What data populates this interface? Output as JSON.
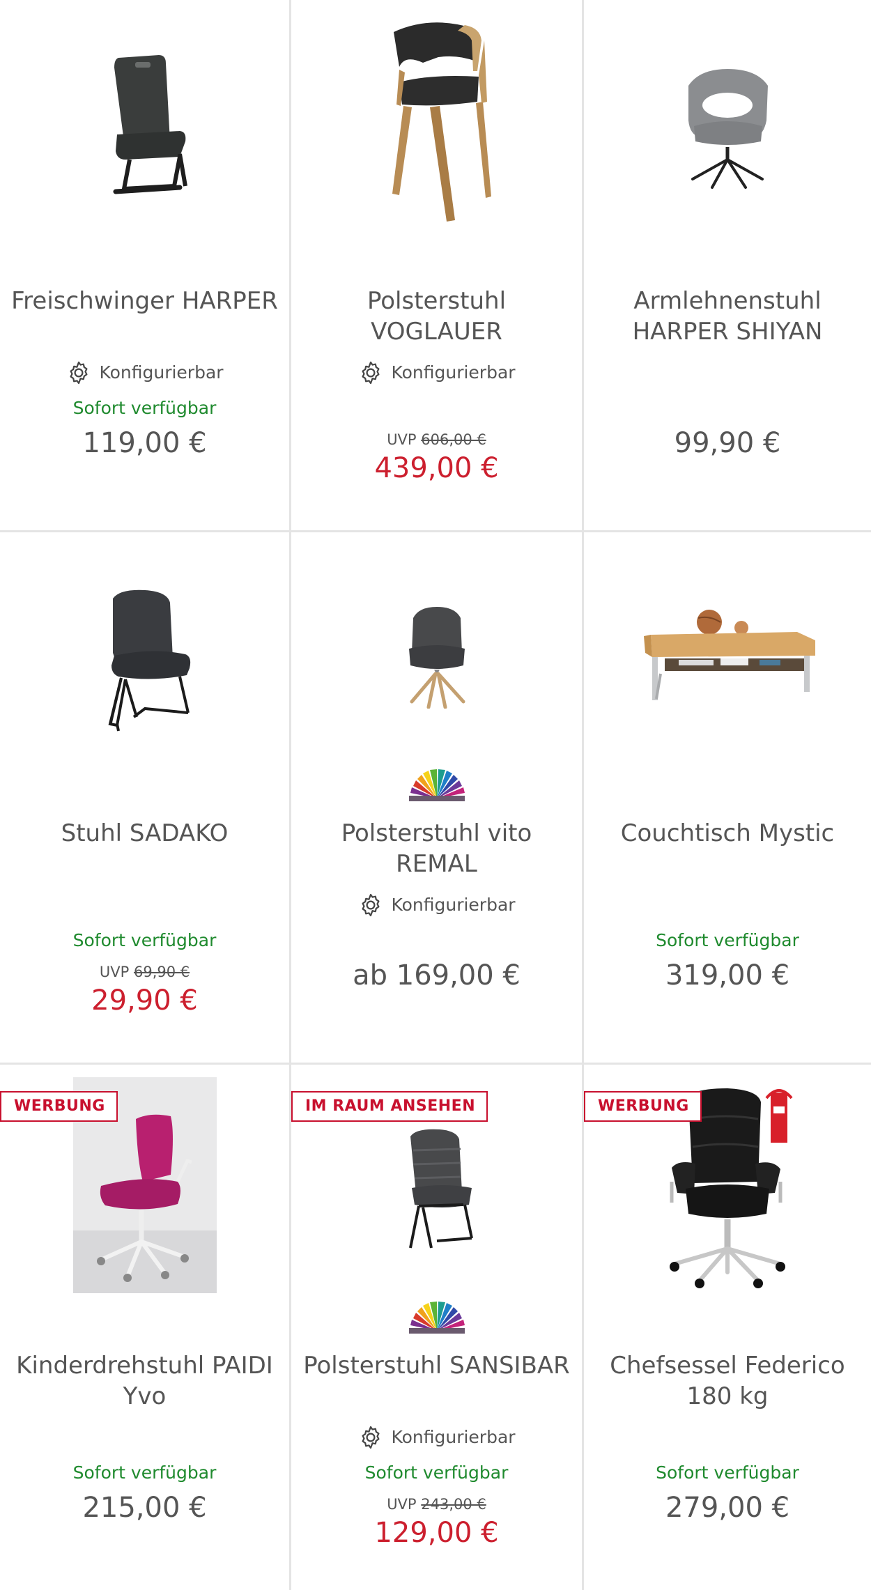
{
  "products": [
    {
      "title": "Freischwinger HARPER",
      "configurable": "Konfigurierbar",
      "availability": "Sofort verfügbar",
      "price": "119,00 €"
    },
    {
      "title": "Polsterstuhl VOGLAUER",
      "configurable": "Konfigurierbar",
      "uvp_label": "UVP",
      "uvp_price": "606,00 €",
      "price": "439,00 €"
    },
    {
      "title": "Armlehnenstuhl HARPER SHIYAN",
      "price": "99,90 €"
    },
    {
      "title": "Stuhl SADAKO",
      "availability": "Sofort verfügbar",
      "uvp_label": "UVP",
      "uvp_price": "69,90 €",
      "price": "29,90 €"
    },
    {
      "title": "Polsterstuhl vito REMAL",
      "configurable": "Konfigurierbar",
      "price": "ab 169,00 €"
    },
    {
      "title": "Couchtisch Mystic",
      "availability": "Sofort verfügbar",
      "price": "319,00 €"
    },
    {
      "badge": "WERBUNG",
      "title": "Kinderdrehstuhl PAIDI Yvo",
      "availability": "Sofort verfügbar",
      "price": "215,00 €"
    },
    {
      "badge": "IM RAUM ANSEHEN",
      "title": "Polsterstuhl SANSIBAR",
      "configurable": "Konfigurierbar",
      "availability": "Sofort verfügbar",
      "uvp_label": "UVP",
      "uvp_price": "243,00 €",
      "price": "129,00 €"
    },
    {
      "badge": "WERBUNG",
      "title": "Chefsessel Federico 180 kg",
      "availability": "Sofort verfügbar",
      "price": "279,00 €"
    }
  ],
  "colors": {
    "sale": "#cc1f2e",
    "available": "#1f8a2e",
    "badge": "#c8102e",
    "text": "#555555",
    "divider": "#e4e4e4"
  },
  "icons": {
    "configurable": "gear-icon",
    "colors": "color-fan-icon"
  }
}
